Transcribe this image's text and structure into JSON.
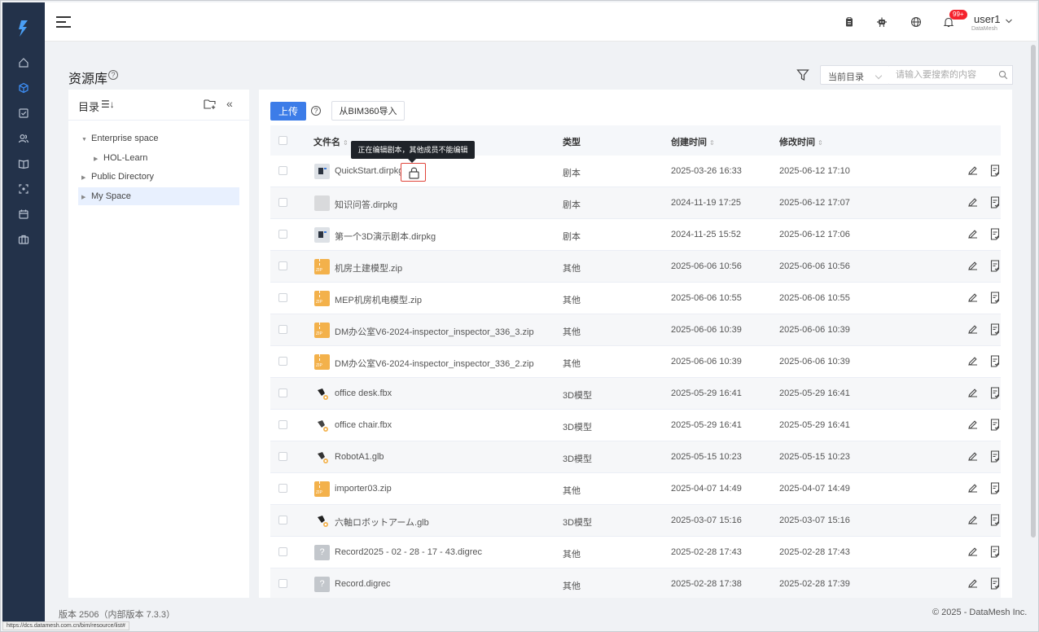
{
  "header": {
    "notification_badge": "99+",
    "user_name": "user1",
    "user_org": "DataMesh"
  },
  "page": {
    "title": "资源库"
  },
  "search": {
    "scope": "当前目录",
    "placeholder": "请输入要搜索的内容"
  },
  "directory": {
    "title": "目录",
    "sort_label": "☰↓",
    "tree": [
      {
        "label": "Enterprise space",
        "expanded": true,
        "level": 0
      },
      {
        "label": "HOL-Learn",
        "expanded": false,
        "level": 1
      },
      {
        "label": "Public Directory",
        "expanded": false,
        "level": 0
      },
      {
        "label": "My Space",
        "expanded": false,
        "level": 0,
        "selected": true
      }
    ]
  },
  "toolbar": {
    "upload_label": "上传",
    "import_label": "从BIM360导入"
  },
  "table": {
    "columns": {
      "name": "文件名",
      "type": "类型",
      "created": "创建时间",
      "modified": "修改时间"
    },
    "lock_tooltip": "正在编辑剧本，其他成员不能编辑",
    "rows": [
      {
        "name": "QuickStart.dirpkg",
        "type": "剧本",
        "created": "2025-03-26 16:33",
        "modified": "2025-06-12 17:10",
        "thumb": "script",
        "locked": true
      },
      {
        "name": "知识问答.dirpkg",
        "type": "剧本",
        "created": "2024-11-19 17:25",
        "modified": "2025-06-12 17:07",
        "thumb": "blank"
      },
      {
        "name": "第一个3D演示剧本.dirpkg",
        "type": "剧本",
        "created": "2024-11-25 15:52",
        "modified": "2025-06-12 17:06",
        "thumb": "script"
      },
      {
        "name": "机房土建模型.zip",
        "type": "其他",
        "created": "2025-06-06 10:56",
        "modified": "2025-06-06 10:56",
        "thumb": "zip"
      },
      {
        "name": "MEP机房机电模型.zip",
        "type": "其他",
        "created": "2025-06-06 10:55",
        "modified": "2025-06-06 10:55",
        "thumb": "zip"
      },
      {
        "name": "DM办公室V6-2024-inspector_inspector_336_3.zip",
        "type": "其他",
        "created": "2025-06-06 10:39",
        "modified": "2025-06-06 10:39",
        "thumb": "zip"
      },
      {
        "name": "DM办公室V6-2024-inspector_inspector_336_2.zip",
        "type": "其他",
        "created": "2025-06-06 10:39",
        "modified": "2025-06-06 10:39",
        "thumb": "zip"
      },
      {
        "name": "office desk.fbx",
        "type": "3D模型",
        "created": "2025-05-29 16:41",
        "modified": "2025-05-29 16:41",
        "thumb": "model"
      },
      {
        "name": "office chair.fbx",
        "type": "3D模型",
        "created": "2025-05-29 16:41",
        "modified": "2025-05-29 16:41",
        "thumb": "model"
      },
      {
        "name": "RobotA1.glb",
        "type": "3D模型",
        "created": "2025-05-15 10:23",
        "modified": "2025-05-15 10:23",
        "thumb": "model"
      },
      {
        "name": "importer03.zip",
        "type": "其他",
        "created": "2025-04-07 14:49",
        "modified": "2025-04-07 14:49",
        "thumb": "zip"
      },
      {
        "name": "六軸ロボットアーム.glb",
        "type": "3D模型",
        "created": "2025-03-07 15:16",
        "modified": "2025-03-07 15:16",
        "thumb": "model"
      },
      {
        "name": "Record2025 - 02 - 28 - 17 - 43.digrec",
        "type": "其他",
        "created": "2025-02-28 17:43",
        "modified": "2025-02-28 17:43",
        "thumb": "unknown"
      },
      {
        "name": "Record.digrec",
        "type": "其他",
        "created": "2025-02-28 17:38",
        "modified": "2025-02-28 17:39",
        "thumb": "unknown"
      }
    ]
  },
  "footer": {
    "version": "版本 2506（内部版本 7.3.3）",
    "copyright": "© 2025 - DataMesh Inc."
  },
  "status_bar": {
    "url": "https://dcs.datamesh.com.cn/bim/resource/list#"
  },
  "colors": {
    "sidebar_bg": "#23324a",
    "primary": "#3c7ce8",
    "lock_highlight": "#e0443a",
    "zip_icon": "#f3b14b"
  },
  "icons": {
    "rail": [
      "home-icon",
      "cube-icon",
      "checklist-icon",
      "users-icon",
      "book-icon",
      "scan-icon",
      "calendar-icon",
      "toolbox-icon"
    ],
    "topbar": [
      "clipboard-icon",
      "robot-icon",
      "globe-icon",
      "bell-icon"
    ]
  }
}
